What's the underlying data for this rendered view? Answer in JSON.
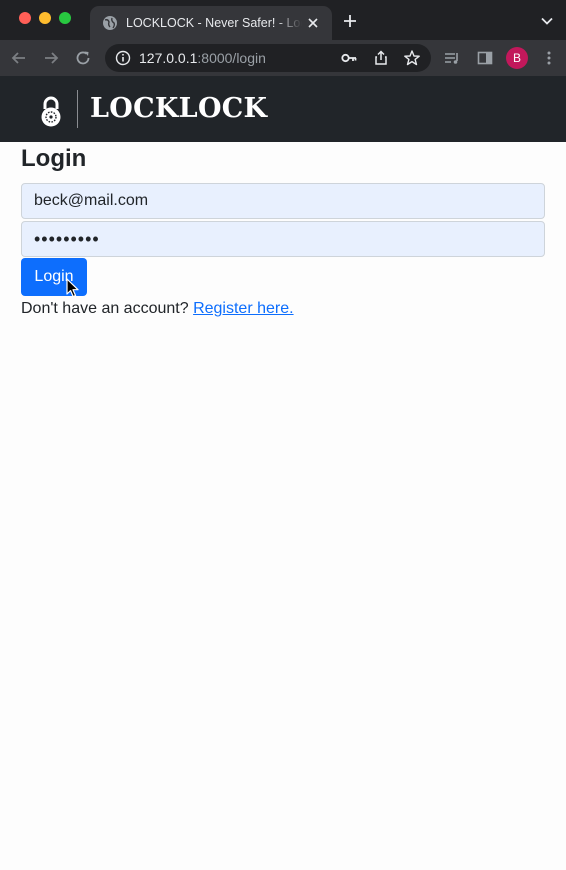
{
  "browser": {
    "tab_title": "LOCKLOCK - Never Safer! - Login",
    "url_host": "127.0.0.1",
    "url_rest": ":8000/login",
    "profile_initial": "B",
    "icons": [
      "globe-icon",
      "close-icon",
      "plus-icon",
      "chevron-down-icon",
      "back-arrow-icon",
      "forward-arrow-icon",
      "reload-icon",
      "info-icon",
      "key-icon",
      "share-icon",
      "star-icon",
      "reading-list-icon",
      "side-panel-icon",
      "more-vert-icon"
    ]
  },
  "navbar": {
    "brand_name": "LOCKLOCK",
    "brand_icon": "padlock-icon"
  },
  "login": {
    "heading": "Login",
    "email_value": "beck@mail.com",
    "password_value": "•••••••••",
    "button_label": "Login"
  },
  "register": {
    "prompt": "Don't have an account? ",
    "link_text": "Register here."
  },
  "colors": {
    "navbar_bg": "#212529",
    "primary": "#0d6efd",
    "autofill_bg": "#e8f0fe",
    "avatar_bg": "#c2185b"
  }
}
